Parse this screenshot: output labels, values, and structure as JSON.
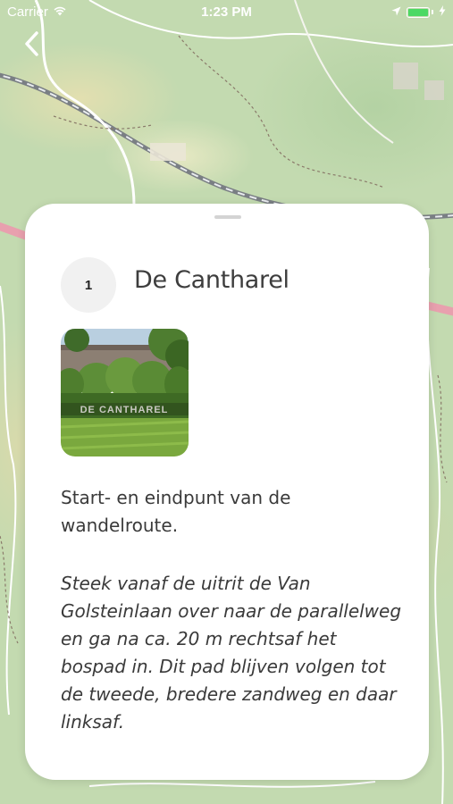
{
  "status_bar": {
    "carrier": "Carrier",
    "time": "1:23 PM",
    "battery_level": 1.0,
    "battery_color": "#4cd964",
    "icons": [
      "wifi-icon",
      "location-arrow-icon",
      "battery-icon",
      "charging-bolt-icon"
    ]
  },
  "navigation": {
    "back_icon": "chevron-left-icon"
  },
  "poi": {
    "number": "1",
    "title": "De Cantharel",
    "photo_sign_text": "DE CANTHAREL",
    "description": "Start- en eindpunt van de wandelroute.",
    "directions": "Steek vanaf de uitrit de Van Golsteinlaan over naar de parallelweg en ga na ca. 20 m rechtsaf het bospad in. Dit pad blijven volgen tot de tweede, bredere zandweg en daar linksaf."
  },
  "colors": {
    "map_green": "#c3dab0",
    "card_background": "#ffffff",
    "title_text": "#3d3d3d",
    "number_circle": "#f1f1f1"
  }
}
